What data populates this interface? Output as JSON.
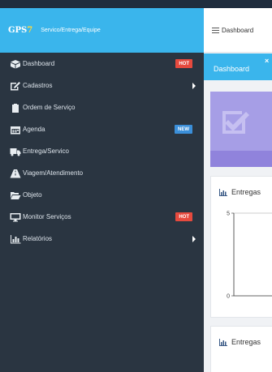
{
  "brand": {
    "logo_main": "GPS",
    "logo_accent": "7",
    "subtitle": "Servico/Entrega/Equipe"
  },
  "sidebar": {
    "items": [
      {
        "label": "Dashboard",
        "icon": "dashboard-icon",
        "badge": "HOT"
      },
      {
        "label": "Cadastros",
        "icon": "edit-icon",
        "submenu": true
      },
      {
        "label": "Ordem de Serviço",
        "icon": "clipboard-icon"
      },
      {
        "label": "Agenda",
        "icon": "calendar-icon",
        "badge": "NEW"
      },
      {
        "label": "Entrega/Servico",
        "icon": "truck-icon"
      },
      {
        "label": "Viagem/Atendimento",
        "icon": "road-icon"
      },
      {
        "label": "Objeto",
        "icon": "folder-open-icon"
      },
      {
        "label": "Monitor Serviços",
        "icon": "monitor-icon",
        "badge": "HOT"
      },
      {
        "label": "Relatórios",
        "icon": "bar-chart-icon",
        "submenu": true
      }
    ]
  },
  "navbar": {
    "breadcrumb": "Dashboard"
  },
  "tabs": [
    {
      "label": "Dashboard",
      "close": "×"
    }
  ],
  "panels": [
    {
      "title": "Entregas"
    },
    {
      "title": "Entregas"
    }
  ],
  "chart_data": {
    "type": "line",
    "title": "Entregas",
    "ylim": [
      0,
      5
    ],
    "y_ticks": [
      "5",
      "0"
    ],
    "series": []
  },
  "colors": {
    "brand_bar": "#3ab5ec",
    "sidebar_bg": "#2a3541",
    "badge_hot": "#e64a3e",
    "badge_new": "#3b8fd9",
    "infobox": "#a69ee6"
  }
}
